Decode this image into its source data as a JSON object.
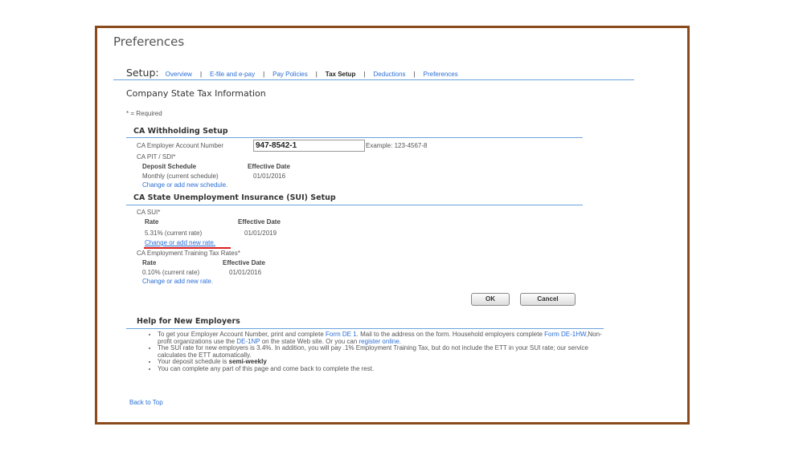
{
  "page_title": "Preferences",
  "setup_nav": {
    "label": "Setup:",
    "items": [
      {
        "label": "Overview",
        "current": false
      },
      {
        "label": "E-file and e-pay",
        "current": false
      },
      {
        "label": "Pay Policies",
        "current": false
      },
      {
        "label": "Tax Setup",
        "current": true
      },
      {
        "label": "Deductions",
        "current": false
      },
      {
        "label": "Preferences",
        "current": false
      }
    ],
    "separator": "|"
  },
  "section_title": "Company State Tax Information",
  "required_note": "* = Required",
  "withholding": {
    "heading": "CA Withholding Setup",
    "account_label": "CA Employer Account Number",
    "account_value": "947-8542-1",
    "account_example": "Example: 123-4567-8",
    "pit_label": "CA PIT / SDI*",
    "col_schedule": "Deposit Schedule",
    "col_date": "Effective Date",
    "schedule_value": "Monthly (current schedule)",
    "schedule_date": "01/01/2016",
    "change_link": "Change or add new schedule."
  },
  "sui": {
    "heading": "CA State Unemployment Insurance (SUI) Setup",
    "sui_label": "CA SUI*",
    "col_rate": "Rate",
    "col_date": "Effective Date",
    "rate_value": "5.31% (current rate)",
    "rate_date": "01/01/2019",
    "change_link": "Change or add new rate.",
    "ett_label": "CA Employment Training Tax Rates*",
    "ett_col_rate": "Rate",
    "ett_col_date": "Effective Date",
    "ett_value": "0.10% (current rate)",
    "ett_date": "01/01/2016",
    "ett_change_link": "Change or add new rate.",
    "highlight_color": "#d9201f"
  },
  "buttons": {
    "ok": "OK",
    "cancel": "Cancel"
  },
  "help": {
    "heading": "Help for New Employers",
    "b1": {
      "t1": "To get your Employer Account Number, print and complete ",
      "l1": "Form DE 1",
      "t2": ". Mail to the address on the form. Household employers complete ",
      "l2": "Form DE-1HW",
      "t3": ",Non-profit organizations use the ",
      "l3": "DE-1NP",
      "t4": " on the state Web site. Or you can ",
      "l4": "register online",
      "t5": "."
    },
    "b2": "The SUI rate for new employers is 3.4%. In addition, you will pay .1% Employment Training Tax, but do not include the ETT in your SUI rate; our service calculates the ETT automatically.",
    "b3_text": "Your deposit schedule is ",
    "b3_bold": "semi-weekly",
    "b4": "You can complete any part of this page and come back to complete the rest."
  },
  "back_to_top": "Back to Top",
  "colors": {
    "frame": "#8a4a1c",
    "link": "#2a6ed6",
    "rule": "#6aa3dc"
  }
}
